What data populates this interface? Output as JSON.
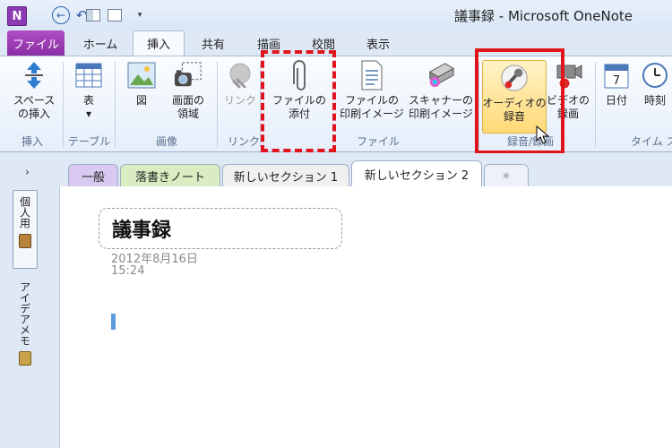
{
  "window": {
    "title": "議事録 - Microsoft OneNote",
    "app_icon_letter": "N"
  },
  "quick_access": {
    "save_icon": "save-icon",
    "back_icon": "back-arrow-icon",
    "undo_icon": "undo-icon",
    "customize_icon": "▾"
  },
  "tabs": [
    {
      "label": "ファイル"
    },
    {
      "label": "ホーム"
    },
    {
      "label": "挿入"
    },
    {
      "label": "共有"
    },
    {
      "label": "描画"
    },
    {
      "label": "校閲"
    },
    {
      "label": "表示"
    }
  ],
  "ribbon": {
    "space": {
      "label": "スペース\nの挿入",
      "group": "挿入"
    },
    "table": {
      "label": "表\n▾",
      "group": "テーブル"
    },
    "picture": {
      "label": "図"
    },
    "screen_clip": {
      "label": "画面の\n領域"
    },
    "images_group": "画像",
    "link": {
      "label": "リンク",
      "group": "リンク"
    },
    "attach": {
      "label": "ファイルの\n添付"
    },
    "printout": {
      "label": "ファイルの\n印刷イメージ"
    },
    "scanner": {
      "label": "スキャナーの\n印刷イメージ"
    },
    "files_group": "ファイル",
    "audio": {
      "label": "オーディオの\n録音"
    },
    "video": {
      "label": "ビデオの\n録画"
    },
    "record_group": "録音/録画",
    "date": {
      "label": "日付",
      "day": "7"
    },
    "time": {
      "label": "時刻"
    },
    "timestamp_group": "タイム スタンプ"
  },
  "sections": {
    "collapse": "›",
    "tabs": [
      "一般",
      "落書きノート",
      "新しいセクション 1",
      "新しいセクション 2"
    ],
    "new_tab": "✳"
  },
  "notebooks": [
    {
      "label": "個人用",
      "color": "#b9823a"
    },
    {
      "label": "アイデアメモ",
      "color": "#c9a24a"
    }
  ],
  "page": {
    "title": "議事録",
    "date": "2012年8月16日",
    "time": "15:24"
  },
  "colors": {
    "highlight_red": "#e0141c",
    "file_tab": "#9b3cb5",
    "selected_button": "#ffd977"
  }
}
